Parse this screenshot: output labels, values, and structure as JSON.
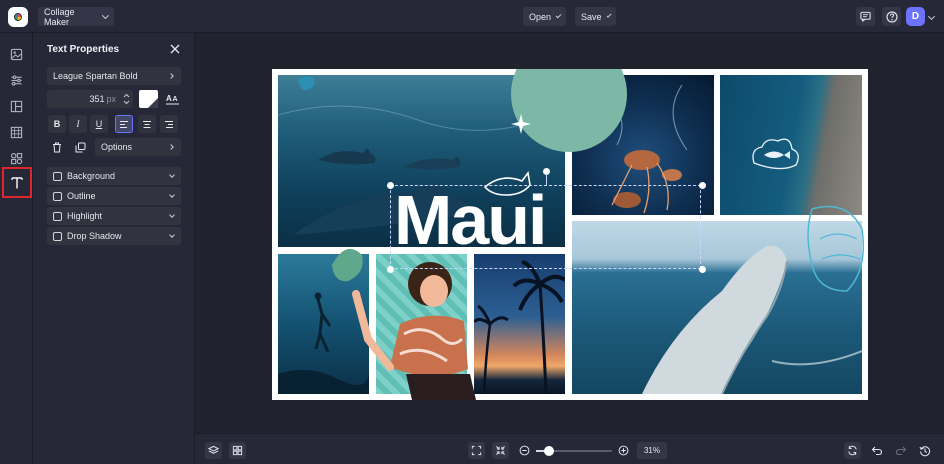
{
  "topbar": {
    "app_menu": "Collage Maker",
    "open_label": "Open",
    "save_label": "Save",
    "user_initial": "D"
  },
  "rail": {
    "items": [
      "image-icon",
      "sliders-icon",
      "layout-icon",
      "texture-icon",
      "graphics-icon",
      "text-icon"
    ],
    "active": "text-icon"
  },
  "panel": {
    "title": "Text Properties",
    "font_name": "League Spartan Bold",
    "font_size": "351",
    "font_unit": "px",
    "text_color": "#ffffff",
    "format_buttons": [
      "B",
      "I",
      "U"
    ],
    "alignment": "left",
    "options_label": "Options",
    "sections": [
      "Background",
      "Outline",
      "Highlight",
      "Drop Shadow"
    ]
  },
  "canvas": {
    "headline": "Maui"
  },
  "bottombar": {
    "zoom_level": "31%",
    "zoom_fraction": 0.17
  },
  "colors": {
    "accent": "#6b73ff",
    "active_rail_outline": "#e0262a",
    "teal_circle": "#7db8a6"
  }
}
